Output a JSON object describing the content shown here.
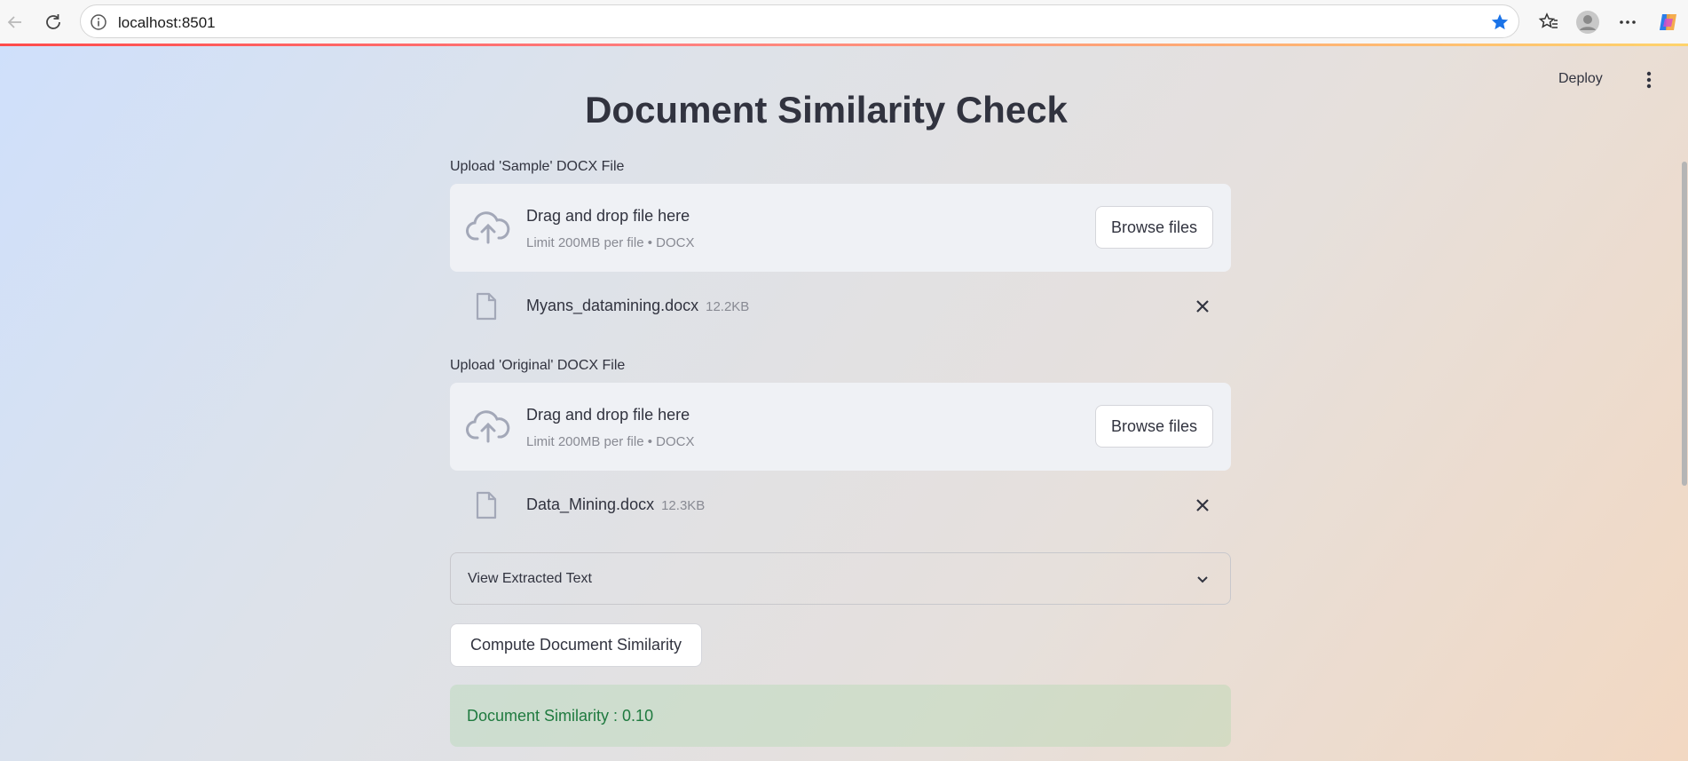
{
  "browser": {
    "url": "localhost:8501",
    "icons": {
      "back": "back-arrow-icon",
      "reload": "reload-icon",
      "info": "info-icon",
      "favorite": "star-icon",
      "favorites_list": "favorites-icon",
      "profile": "profile-icon",
      "more": "more-icon",
      "copilot": "copilot-icon"
    },
    "colors": {
      "star": "#1a73e8"
    }
  },
  "header": {
    "deploy_label": "Deploy"
  },
  "page": {
    "title": "Document Similarity Check"
  },
  "uploaders": [
    {
      "label": "Upload 'Sample' DOCX File",
      "dropzone_text": "Drag and drop file here",
      "limit_text": "Limit 200MB per file • DOCX",
      "browse_label": "Browse files",
      "file": {
        "name": "Myans_datamining.docx",
        "size": "12.2KB"
      }
    },
    {
      "label": "Upload 'Original' DOCX File",
      "dropzone_text": "Drag and drop file here",
      "limit_text": "Limit 200MB per file • DOCX",
      "browse_label": "Browse files",
      "file": {
        "name": "Data_Mining.docx",
        "size": "12.3KB"
      }
    }
  ],
  "expander": {
    "label": "View Extracted Text",
    "expanded": false
  },
  "compute_button": {
    "label": "Compute Document Similarity"
  },
  "result": {
    "text": "Document Similarity : 0.10",
    "color": "#1f7a3f"
  }
}
